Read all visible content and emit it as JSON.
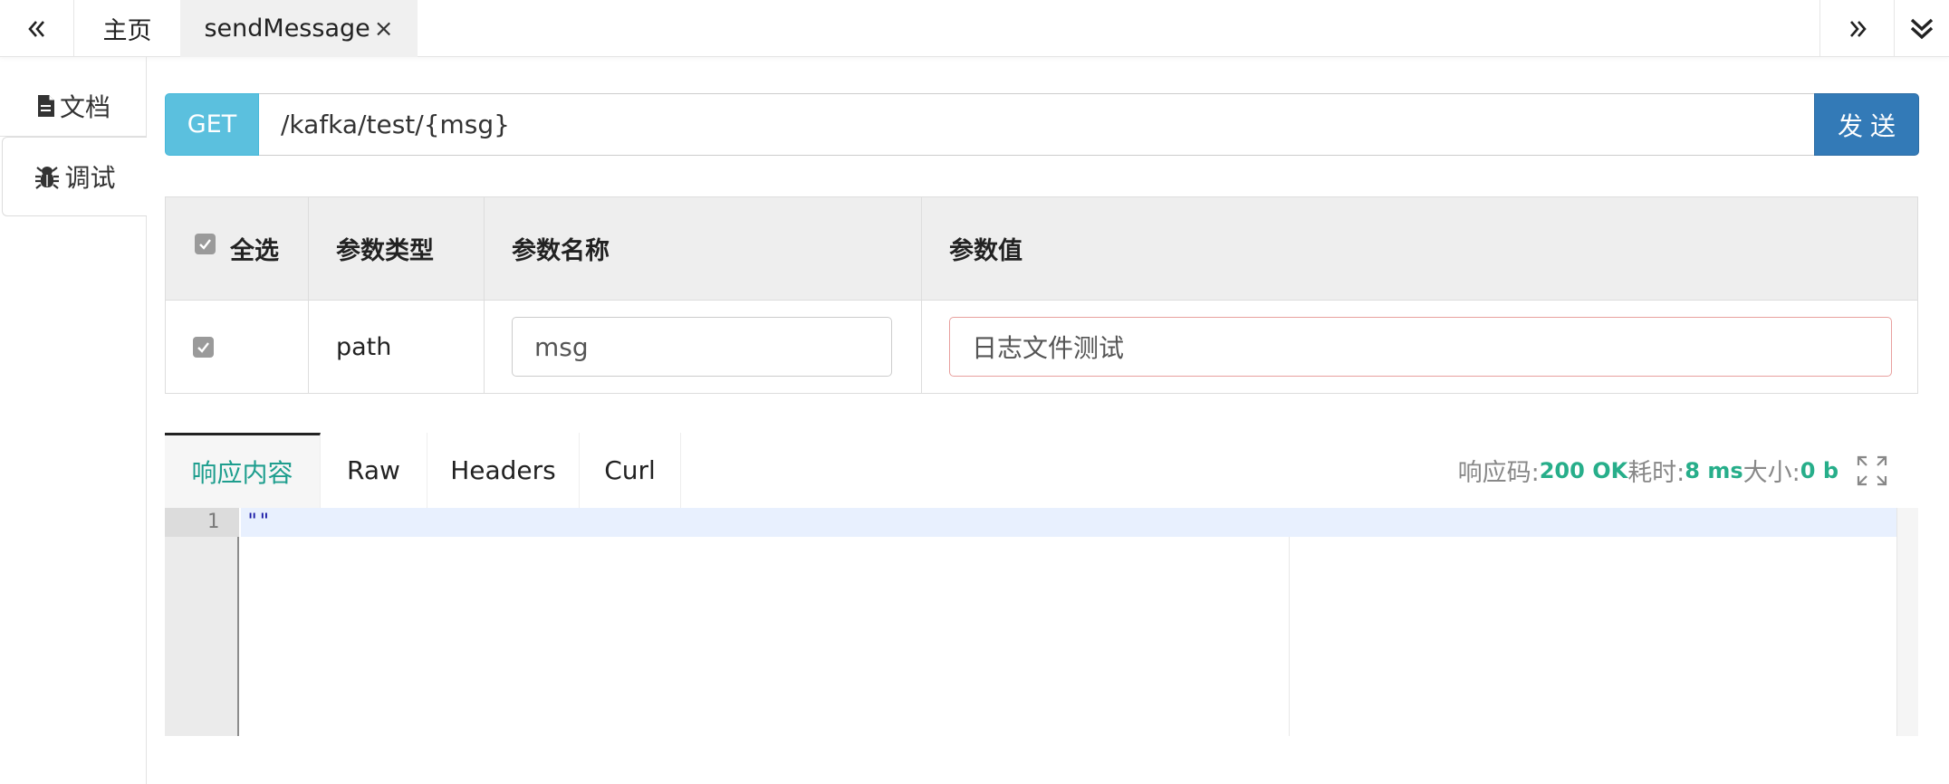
{
  "topbar": {
    "nav_left_icon": "double-chevron-left-icon",
    "tabs": [
      {
        "label": "主页"
      },
      {
        "label": "sendMessage",
        "close": "×",
        "active": true
      }
    ],
    "nav_right_icon": "double-chevron-right-icon",
    "menu_icon": "double-chevron-down-icon"
  },
  "sidebar": {
    "items": [
      {
        "label": "文档",
        "icon": "document-icon"
      },
      {
        "label": "调试",
        "icon": "bug-icon",
        "active": true
      }
    ]
  },
  "request": {
    "method": "GET",
    "url": "/kafka/test/{msg}",
    "send_label": "发送",
    "colors": {
      "method_bg": "#5bc0de",
      "send_bg": "#337ab7"
    }
  },
  "params": {
    "headers": {
      "select_all": "全选",
      "type": "参数类型",
      "name": "参数名称",
      "value": "参数值"
    },
    "rows": [
      {
        "checked": true,
        "type": "path",
        "name": "msg",
        "value": "日志文件测试"
      }
    ]
  },
  "response": {
    "tabs": [
      {
        "label": "响应内容",
        "active": true
      },
      {
        "label": "Raw"
      },
      {
        "label": "Headers"
      },
      {
        "label": "Curl"
      }
    ],
    "status_label": "响应码:",
    "status_value": "200 OK",
    "time_label": "耗时:",
    "time_value": "8 ms",
    "size_label": "大小:",
    "size_value": "0 b",
    "fullscreen_icon": "fullscreen-icon",
    "accent_color": "#1e9e8e"
  },
  "editor": {
    "lines": [
      {
        "number": "1",
        "text": "\"\""
      }
    ]
  }
}
